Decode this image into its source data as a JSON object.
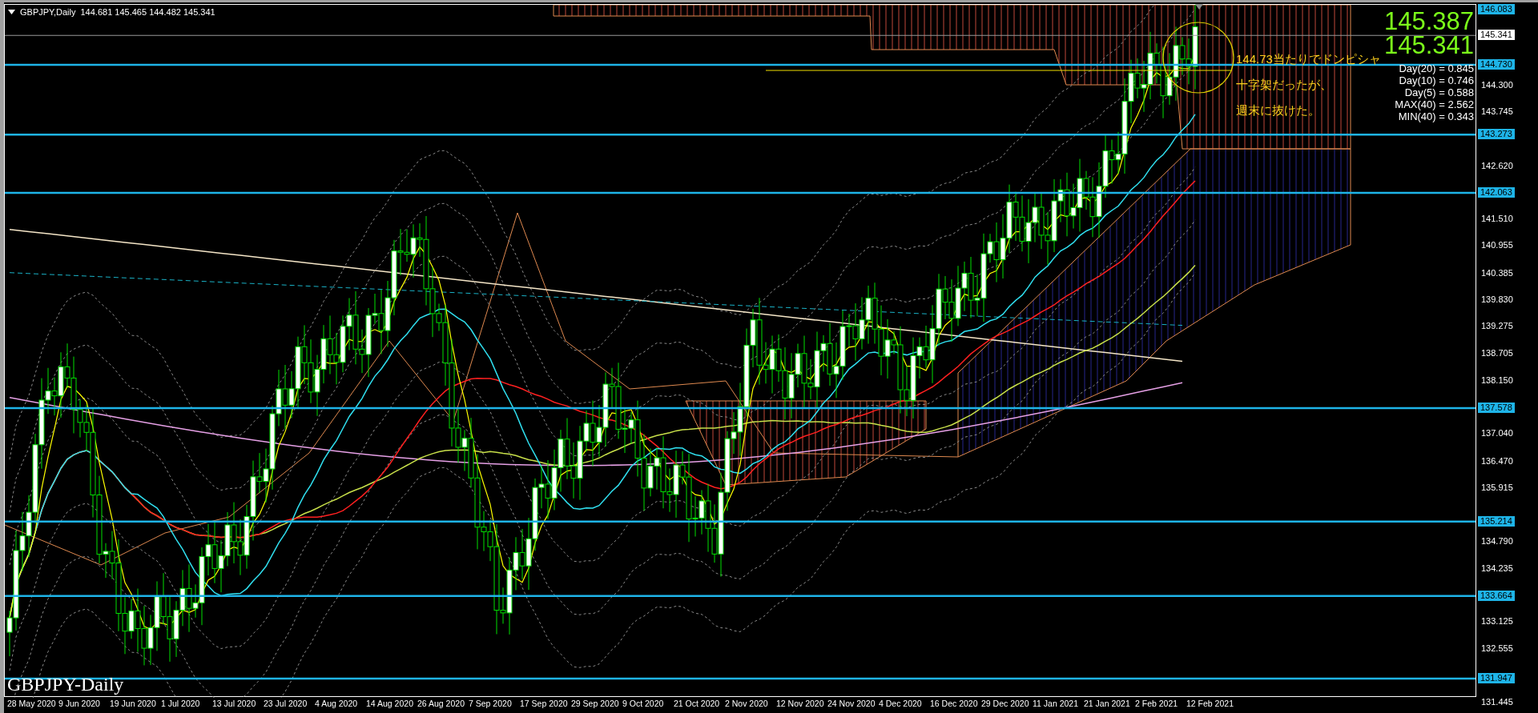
{
  "chart_header": {
    "symbol": "GBPJPY,Daily",
    "ohlc": "144.681 145.465 144.482 145.341"
  },
  "price_readouts": [
    "145.387",
    "145.341"
  ],
  "stats": [
    "Day(20) = 0.845",
    "Day(10) = 0.746",
    "Day(5) = 0.588",
    "MAX(40) = 2.562",
    "MIN(40) = 0.343"
  ],
  "annotation": [
    "144.73当たりでドンピシャ",
    "十字架だったが、",
    "週末に抜けた。"
  ],
  "chart_label": "GBPJPY-Daily",
  "price_axis": {
    "ticks": [
      "144.300",
      "143.745",
      "142.620",
      "141.510",
      "140.955",
      "140.385",
      "139.830",
      "139.275",
      "138.705",
      "138.150",
      "137.040",
      "136.470",
      "135.915",
      "134.790",
      "134.235",
      "133.125",
      "132.555",
      "131.445"
    ],
    "levels": [
      "146.083",
      "144.730",
      "143.273",
      "142.063",
      "137.578",
      "135.214",
      "133.664",
      "131.947"
    ],
    "current_price": "145.341"
  },
  "time_axis": {
    "labels": [
      "28 May 2020",
      "9 Jun 2020",
      "19 Jun 2020",
      "1 Jul 2020",
      "13 Jul 2020",
      "23 Jul 2020",
      "4 Aug 2020",
      "14 Aug 2020",
      "26 Aug 2020",
      "7 Sep 2020",
      "17 Sep 2020",
      "29 Sep 2020",
      "9 Oct 2020",
      "21 Oct 2020",
      "2 Nov 2020",
      "12 Nov 2020",
      "24 Nov 2020",
      "4 Dec 2020",
      "16 Dec 2020",
      "29 Dec 2020",
      "11 Jan 2021",
      "21 Jan 2021",
      "2 Feb 2021",
      "12 Feb 2021"
    ]
  }
}
